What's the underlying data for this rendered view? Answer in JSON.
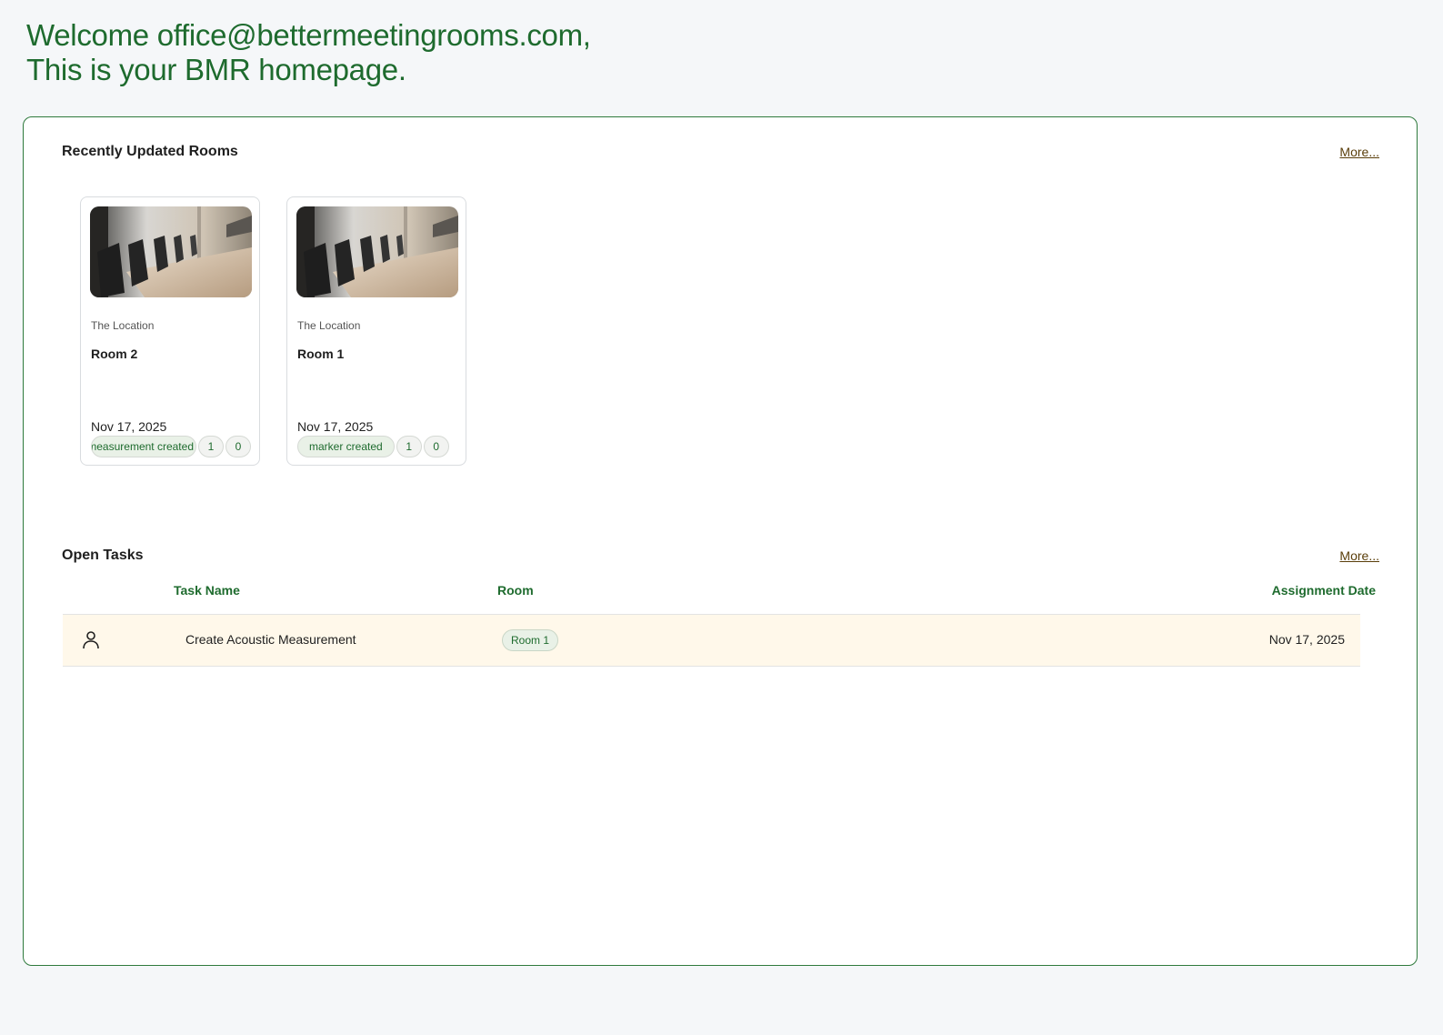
{
  "welcome": {
    "line1": "Welcome office@bettermeetingrooms.com,",
    "line2": "This is your BMR homepage."
  },
  "recent_rooms": {
    "title": "Recently Updated Rooms",
    "more_label": "More...",
    "cards": [
      {
        "location": "The Location",
        "name": "Room 2",
        "date": "Nov 17, 2025",
        "tag": "acoustic measurement created",
        "count1": "1",
        "count2": "0"
      },
      {
        "location": "The Location",
        "name": "Room 1",
        "date": "Nov 17, 2025",
        "tag": "marker created",
        "count1": "1",
        "count2": "0"
      }
    ]
  },
  "open_tasks": {
    "title": "Open Tasks",
    "more_label": "More...",
    "columns": {
      "task_name": "Task Name",
      "room": "Room",
      "assignment_date": "Assignment Date"
    },
    "rows": [
      {
        "icon": "user-icon",
        "task_name": "Create Acoustic Measurement",
        "room": "Room 1",
        "assignment_date": "Nov 17, 2025"
      }
    ]
  },
  "colors": {
    "accent_green": "#1e6b2e",
    "panel_border": "#2f7a3d",
    "row_highlight": "#fff8ea",
    "link_brown": "#5a3e0a"
  }
}
